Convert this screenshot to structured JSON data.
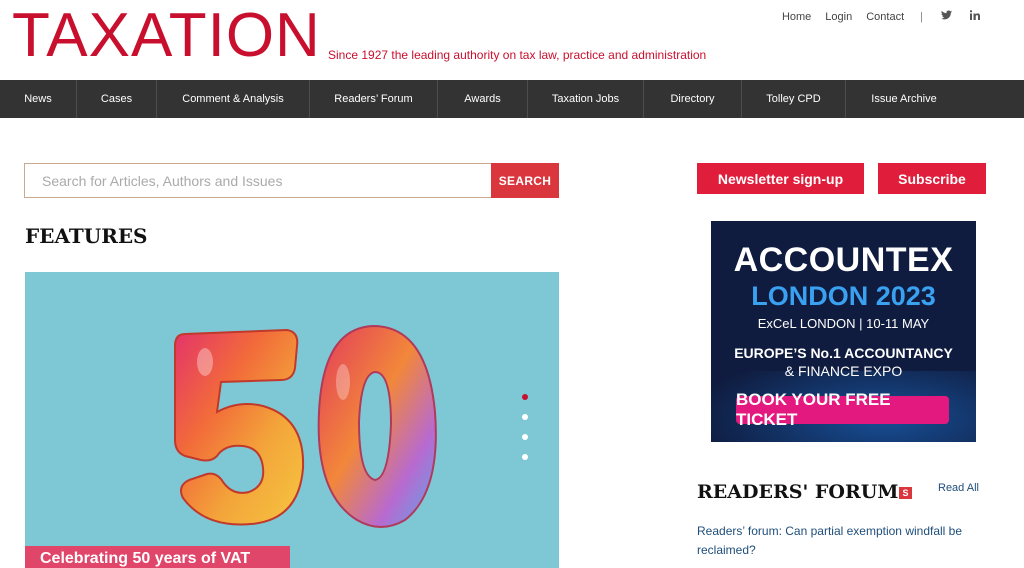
{
  "header": {
    "logo": "TAXATION",
    "tagline": "Since 1927 the leading authority on tax law, practice and administration",
    "links": [
      "Home",
      "Login",
      "Contact"
    ],
    "separator": "|",
    "social": {
      "twitter": "twitter-icon",
      "linkedin": "linkedin-icon"
    }
  },
  "nav": {
    "items": [
      "News",
      "Cases",
      "Comment & Analysis",
      "Readers’ Forum",
      "Awards",
      "Taxation Jobs",
      "Directory",
      "Tolley CPD",
      "Issue Archive"
    ]
  },
  "search": {
    "placeholder": "Search for Articles, Authors and Issues",
    "button": "SEARCH"
  },
  "features": {
    "title": "FEATURES",
    "caption": "Celebrating 50 years of VAT",
    "slide_count": 4,
    "active_slide": 1
  },
  "sidebar": {
    "newsletter": "Newsletter sign-up",
    "subscribe": "Subscribe",
    "ad": {
      "brand": "ACCOUNTEX",
      "city": "LONDON 2023",
      "venue": "ExCeL LONDON | 10-11 MAY",
      "claim_line1": "EUROPE’S No.1 ACCOUNTANCY",
      "claim_line2": "& FINANCE EXPO",
      "cta": "BOOK YOUR FREE TICKET"
    },
    "readers_forum": {
      "title": "READERS' FORUM",
      "badge": "S",
      "read_all": "Read All",
      "article": "Readers’ forum: Can partial exemption windfall be reclaimed?"
    }
  },
  "colors": {
    "brand_red": "#c8102e",
    "nav_bg": "#333333",
    "button_red": "#e01e3c",
    "feature_bg": "#7ec8d6",
    "caption_pink": "#e0456a",
    "link_blue": "#1f4e7a"
  }
}
